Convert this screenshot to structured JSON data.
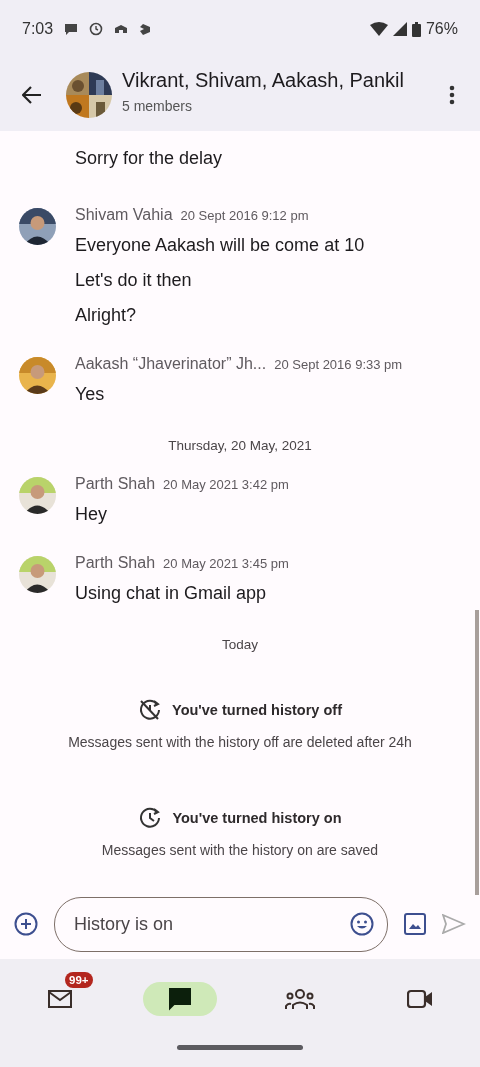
{
  "status_bar": {
    "time": "7:03",
    "battery": "76%"
  },
  "header": {
    "title": "Vikrant, Shivam, Aakash, Pankil",
    "subtitle": "5 members"
  },
  "items": [
    {
      "kind": "continuation",
      "messages": [
        "Sorry for the delay"
      ]
    },
    {
      "kind": "group",
      "sender": "Shivam Vahia",
      "time": "20 Sept 2016 9:12 pm",
      "messages": [
        "Everyone Aakash will be come at 10",
        "Let's do it then",
        "Alright?"
      ]
    },
    {
      "kind": "group",
      "sender": "Aakash “Jhaverinator” Jh...",
      "time": "20 Sept 2016 9:33 pm",
      "messages": [
        "Yes"
      ]
    },
    {
      "kind": "date",
      "text": "Thursday, 20 May, 2021"
    },
    {
      "kind": "group",
      "sender": "Parth Shah",
      "time": "20 May 2021 3:42 pm",
      "messages": [
        "Hey"
      ]
    },
    {
      "kind": "group",
      "sender": "Parth Shah",
      "time": "20 May 2021 3:45 pm",
      "messages": [
        "Using chat in Gmail app"
      ]
    },
    {
      "kind": "date",
      "text": "Today"
    },
    {
      "kind": "history_off_notice",
      "title": "You've turned history off",
      "body": "Messages sent with the history off are deleted after 24h"
    },
    {
      "kind": "history_on_notice",
      "title": "You've turned history on",
      "body": "Messages sent with the history on are saved"
    }
  ],
  "composer": {
    "placeholder": "History is on"
  },
  "nav": [
    {
      "badge": "99+",
      "selected": false
    },
    {
      "selected": true
    },
    {
      "selected": false
    },
    {
      "selected": false
    }
  ]
}
